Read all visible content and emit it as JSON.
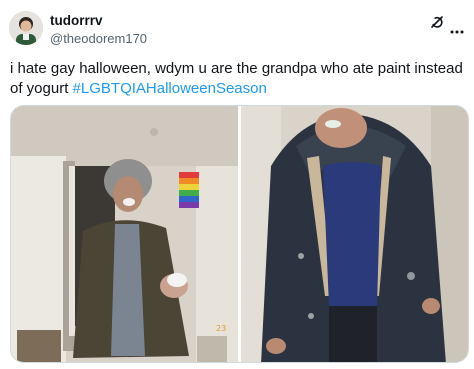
{
  "author": {
    "display_name": "tudorrrv",
    "handle": "@theodorem170"
  },
  "tweet": {
    "text": "i hate gay halloween, wdym u are the grandpa who ate paint instead of yogurt ",
    "hashtag": "#LGBTQIAHalloweenSeason"
  },
  "icons": {
    "grok": "grok-icon",
    "more": "more-icon"
  },
  "media": [
    {
      "name": "costume-photo",
      "caption": ""
    },
    {
      "name": "original-photo",
      "caption": ""
    }
  ],
  "colors": {
    "link": "#1d9bf0",
    "text": "#0f1419",
    "secondary": "#536471",
    "border": "#cfd9de"
  }
}
